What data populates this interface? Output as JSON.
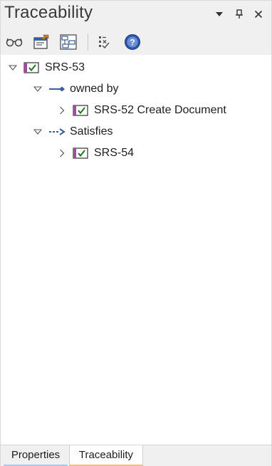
{
  "panel": {
    "title": "Traceability",
    "controls": [
      "dropdown-icon",
      "pin-icon",
      "close-icon"
    ]
  },
  "toolbar": {
    "tools": [
      "glasses-icon",
      "locate-in-browser-icon",
      "diagram-icon",
      "checklist-icon",
      "help-icon"
    ]
  },
  "tree": {
    "root": {
      "label": "SRS-53",
      "expanded": true
    },
    "groups": [
      {
        "label": "owned by",
        "icon": "owned-by-connector-icon",
        "expanded": true,
        "children": [
          {
            "label": "SRS-52 Create Document",
            "expanded": false
          }
        ]
      },
      {
        "label": "Satisfies",
        "icon": "satisfies-connector-icon",
        "expanded": true,
        "children": [
          {
            "label": "SRS-54",
            "expanded": false
          }
        ]
      }
    ]
  },
  "tabs": [
    {
      "label": "Properties",
      "active": false
    },
    {
      "label": "Traceability",
      "active": true
    }
  ],
  "colors": {
    "requirement_icon_border": "#7a2f7a",
    "check": "#1a7a1a",
    "connector": "#3a5f9a",
    "properties_tab_underline": "#a9c8ec",
    "traceability_tab_underline": "#f0c08c"
  }
}
